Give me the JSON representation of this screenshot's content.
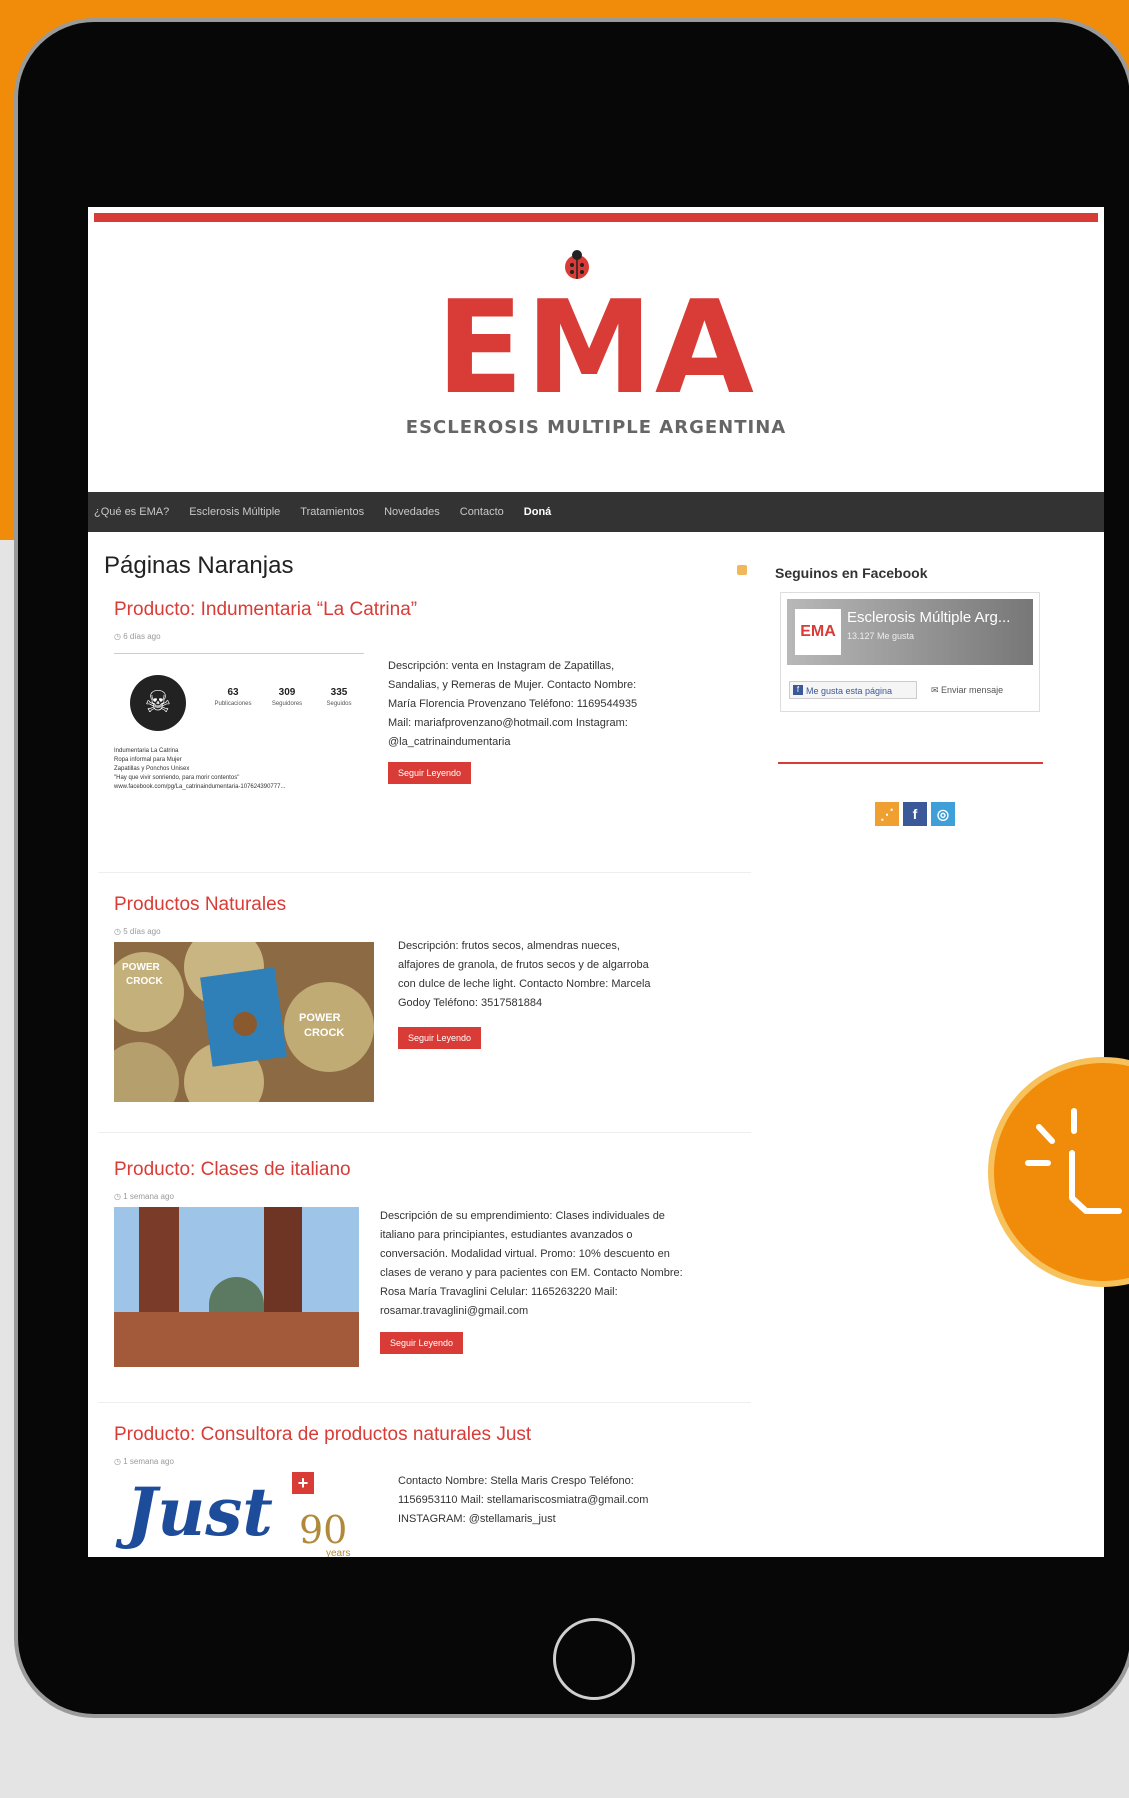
{
  "site": {
    "logo_text": "EMA",
    "logo_subtitle": "ESCLEROSIS MULTIPLE ARGENTINA"
  },
  "nav": {
    "items": [
      "¿Qué es EMA?",
      "Esclerosis Múltiple",
      "Tratamientos",
      "Novedades",
      "Contacto",
      "Doná"
    ]
  },
  "page": {
    "title": "Páginas Naranjas"
  },
  "posts": [
    {
      "title": "Producto: Indumentaria “La Catrina”",
      "date": "6 días ago",
      "description": "Descripción: venta en Instagram de Zapatillas, Sandalias, y Remeras de Mujer. Contacto Nombre: María Florencia Provenzano Teléfono: 1169544935 Mail: mariafprovenzano@hotmail.com Instagram: @la_catrinaindumentaria",
      "button": "Seguir Leyendo",
      "thumb": {
        "posts_count": "63",
        "posts_label": "Publicaciones",
        "followers_count": "309",
        "followers_label": "Seguidores",
        "following_count": "335",
        "following_label": "Seguidos",
        "line1": "Indumentaria La Catrina",
        "line2": "Ropa informal para Mujer",
        "line3": "Zapatillas y Ponchos Unisex",
        "line4": "\"Hay que vivir sonriendo, para morir contentos\"",
        "line5": "www.facebook.com/pg/La_catrinaindumentaria-107624390777..."
      }
    },
    {
      "title": "Productos Naturales",
      "date": "5 días ago",
      "description": "Descripción: frutos secos, almendras nueces, alfajores de granola, de frutos secos y de algarroba con dulce de leche light. Contacto Nombre: Marcela Godoy Teléfono: 3517581884",
      "button": "Seguir Leyendo",
      "thumb": {
        "label_a": "POWER",
        "label_b": "CROCK"
      }
    },
    {
      "title": "Producto: Clases de italiano",
      "date": "1 semana ago",
      "description": "Descripción de su emprendimiento: Clases individuales de italiano para principiantes, estudiantes avanzados o conversación. Modalidad virtual. Promo: 10% descuento en clases de verano y para pacientes con EM. Contacto Nombre: Rosa María Travaglini Celular: 1165263220 Mail: rosamar.travaglini@gmail.com",
      "button": "Seguir Leyendo"
    },
    {
      "title": "Producto: Consultora de productos naturales Just",
      "date": "1 semana ago",
      "description": "Contacto Nombre: Stella Maris Crespo Teléfono: 1156953110 Mail: stellamariscosmiatra@gmail.com INSTAGRAM: @stellamaris_just",
      "thumb": {
        "brand": "Just",
        "years": "90",
        "years_word": "years"
      }
    }
  ],
  "sidebar": {
    "facebook_title": "Seguinos en Facebook",
    "fb_logo": "EMA",
    "fb_page_name": "Esclerosis Múltiple Arg...",
    "fb_likes": "13.127 Me gusta",
    "fb_like_button": "Me gusta esta página",
    "fb_message_button": "Enviar mensaje"
  },
  "colors": {
    "brand_red": "#d93b36",
    "nav_bg": "#333333",
    "orange": "#f18c0a",
    "rss": "#f0a030",
    "facebook": "#3b5998",
    "instagram": "#3f9fd8"
  },
  "icons": {
    "rss": "rss-icon",
    "facebook": "facebook-icon",
    "instagram": "instagram-icon",
    "clock": "clock-icon",
    "home": "home-button",
    "tap": "tap-gesture-icon"
  }
}
